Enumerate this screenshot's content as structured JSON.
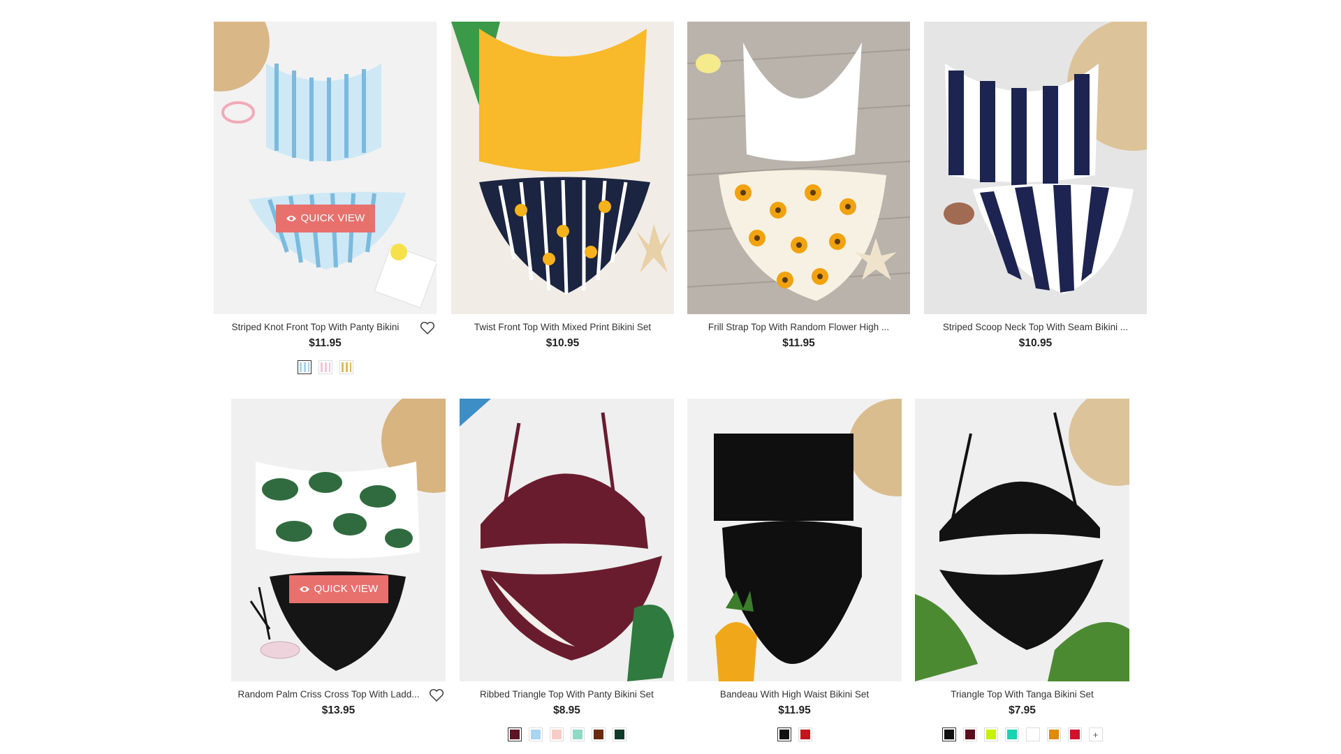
{
  "row1": [
    {
      "title": "Striped Knot Front Top With Panty Bikini",
      "price": "$11.95",
      "quick_view": "QUICK VIEW",
      "swatches": [
        "#a9d3ec",
        "#f4c4d2",
        "#e1bb55"
      ]
    },
    {
      "title": "Twist Front Top With Mixed Print Bikini Set",
      "price": "$10.95"
    },
    {
      "title": "Frill Strap Top With Random Flower High ...",
      "price": "$11.95"
    },
    {
      "title": "Striped Scoop Neck Top With Seam Bikini ...",
      "price": "$10.95"
    }
  ],
  "row2": [
    {
      "title": "Random Palm Criss Cross Top With Ladd...",
      "price": "$13.95",
      "quick_view": "QUICK VIEW"
    },
    {
      "title": "Ribbed Triangle Top With Panty Bikini Set",
      "price": "$8.95",
      "swatches": [
        "#5c1424",
        "#a9d4f2",
        "#f6cdc7",
        "#8fd9c5",
        "#6b2b10",
        "#113a2a"
      ]
    },
    {
      "title": "Bandeau With High Waist Bikini Set",
      "price": "$11.95",
      "swatches": [
        "#111111",
        "#c2161e"
      ]
    },
    {
      "title": "Triangle Top With Tanga Bikini Set",
      "price": "$7.95",
      "swatches": [
        "#111111",
        "#5a0f1c",
        "#c7f205",
        "#19d3b2",
        "#ffffff",
        "#e08a0a",
        "#d3112a"
      ],
      "more_label": "+"
    }
  ]
}
